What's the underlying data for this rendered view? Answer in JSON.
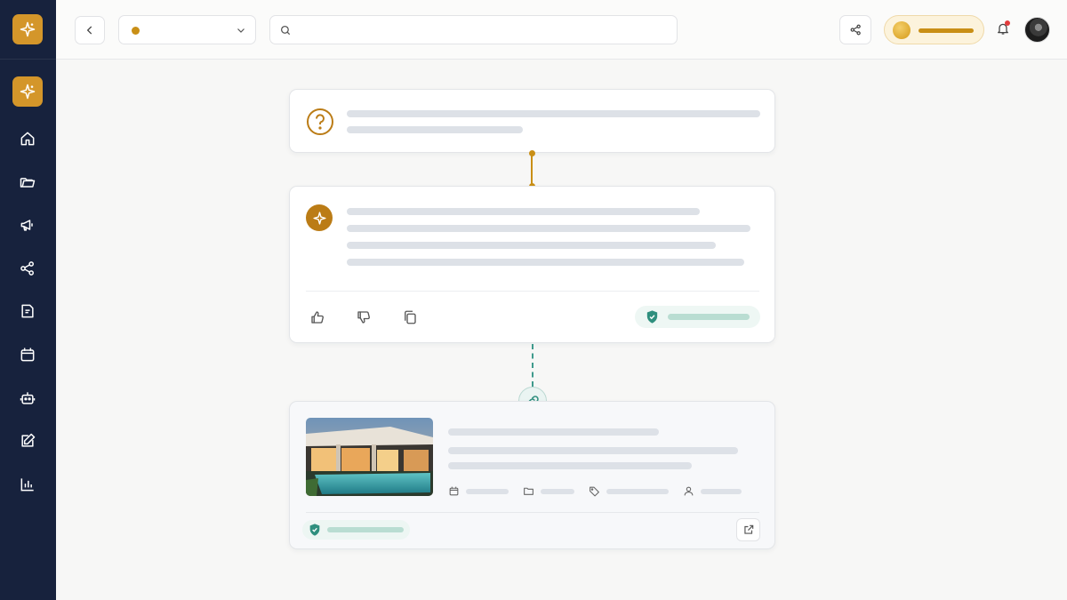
{
  "colors": {
    "sidebar_bg": "#17223d",
    "accent_gold": "#c98f16",
    "accent_teal": "#2f8f7e"
  },
  "sidebar": {
    "logo_icon": "sparkle-icon",
    "items": [
      {
        "icon": "sparkle-icon",
        "active": true
      },
      {
        "icon": "home-icon"
      },
      {
        "icon": "folder-icon"
      },
      {
        "icon": "megaphone-icon"
      },
      {
        "icon": "share-nodes-icon"
      },
      {
        "icon": "document-icon"
      },
      {
        "icon": "calendar-icon"
      },
      {
        "icon": "robot-icon"
      },
      {
        "icon": "edit-icon"
      },
      {
        "icon": "bar-chart-icon"
      }
    ]
  },
  "topbar": {
    "workspace_label": "",
    "search": {
      "placeholder": "",
      "value": ""
    },
    "notifications_unread": true
  },
  "question_card": {
    "icon": "question-circle-icon"
  },
  "answer_card": {
    "icon": "sparkle-icon",
    "actions": [
      "thumbs-up-icon",
      "thumbs-down-icon",
      "copy-icon"
    ],
    "verified_icon": "shield-check-icon"
  },
  "source_card": {
    "thumbnail": "villa-pool-photo",
    "meta_icons": [
      "calendar-icon",
      "folder-icon",
      "tag-icon",
      "user-icon"
    ],
    "verified_icon": "shield-check-icon",
    "open_icon": "external-link-icon"
  }
}
